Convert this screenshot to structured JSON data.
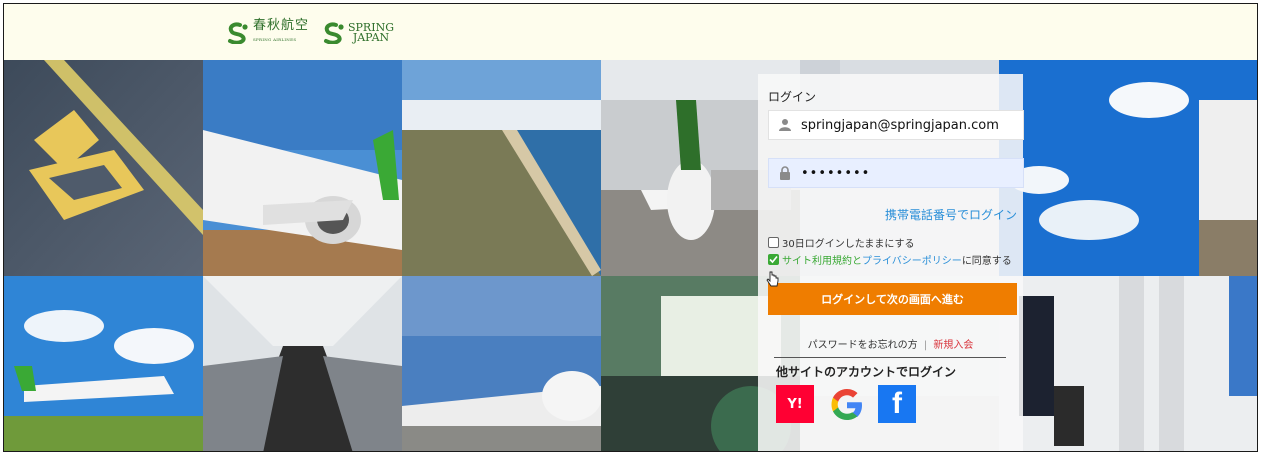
{
  "header": {
    "logo_cn": {
      "text": "春秋航空",
      "sub": "SPRING AIRLINES"
    },
    "logo_en": {
      "line1": "SPRING",
      "line2": "JAPAN"
    }
  },
  "login": {
    "title": "ログイン",
    "email": {
      "value": "springjapan@springjapan.com"
    },
    "password": {
      "value": "••••••••"
    },
    "phone_login": "携帯電話番号でログイン",
    "remember": {
      "label": "30日ログインしたままにする",
      "checked": false
    },
    "agree": {
      "terms": "サイト利用規約",
      "and": "と",
      "privacy": "プライバシーポリシー",
      "suffix": "に同意する",
      "checked": true
    },
    "submit": "ログインして次の画面へ進む",
    "forgot": "パスワードをお忘れの方",
    "separator": "|",
    "register": "新規入会",
    "social_title": "他サイトのアカウントでログイン",
    "social": {
      "yahoo": "Y!",
      "google": "G",
      "facebook": "f"
    }
  },
  "colors": {
    "brand_green": "#2e6f2a",
    "accent_orange": "#ef7d00",
    "link_blue": "#2a8fd8",
    "check_green": "#3aa935",
    "register_red": "#d9363e"
  },
  "icons": [
    "user-icon",
    "lock-icon",
    "checkmark-icon",
    "yahoo-icon",
    "google-icon",
    "facebook-icon",
    "cursor-icon"
  ]
}
